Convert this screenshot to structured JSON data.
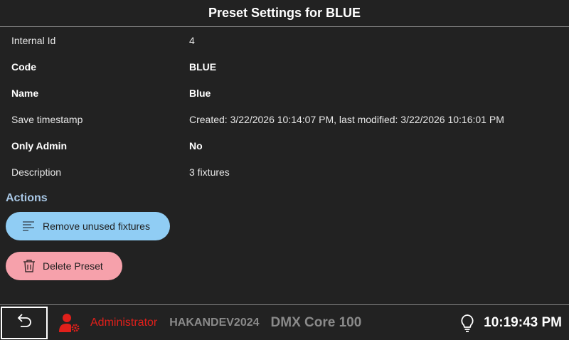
{
  "header": {
    "title": "Preset Settings for BLUE"
  },
  "properties": [
    {
      "label": "Internal Id",
      "value": "4",
      "bold": false
    },
    {
      "label": "Code",
      "value": "BLUE",
      "bold": true
    },
    {
      "label": "Name",
      "value": "Blue",
      "bold": true
    },
    {
      "label": "Save timestamp",
      "value": "Created: 3/22/2026 10:14:07 PM, last modified: 3/22/2026 10:16:01 PM",
      "bold": false
    },
    {
      "label": "Only Admin",
      "value": "No",
      "bold": true
    },
    {
      "label": "Description",
      "value": "3 fixtures",
      "bold": false
    }
  ],
  "actions": {
    "heading": "Actions",
    "remove_unused_label": "Remove unused fixtures",
    "delete_preset_label": "Delete Preset"
  },
  "footer": {
    "user_role": "Administrator",
    "host_name": "HAKANDEV2024",
    "product_name": "DMX Core 100",
    "time": "10:19:43 PM"
  },
  "icons": {
    "back": "undo-arrow-icon",
    "admin": "user-gear-icon",
    "bulb": "lightbulb-icon",
    "remove": "filter-lines-icon",
    "delete": "trash-icon"
  },
  "colors": {
    "background": "#222222",
    "remove_button": "#90cdf4",
    "delete_button": "#f6a1ab",
    "actions_heading": "#a9c8e6",
    "admin_red": "#e0201b",
    "muted_gray": "#8a8a8a"
  }
}
